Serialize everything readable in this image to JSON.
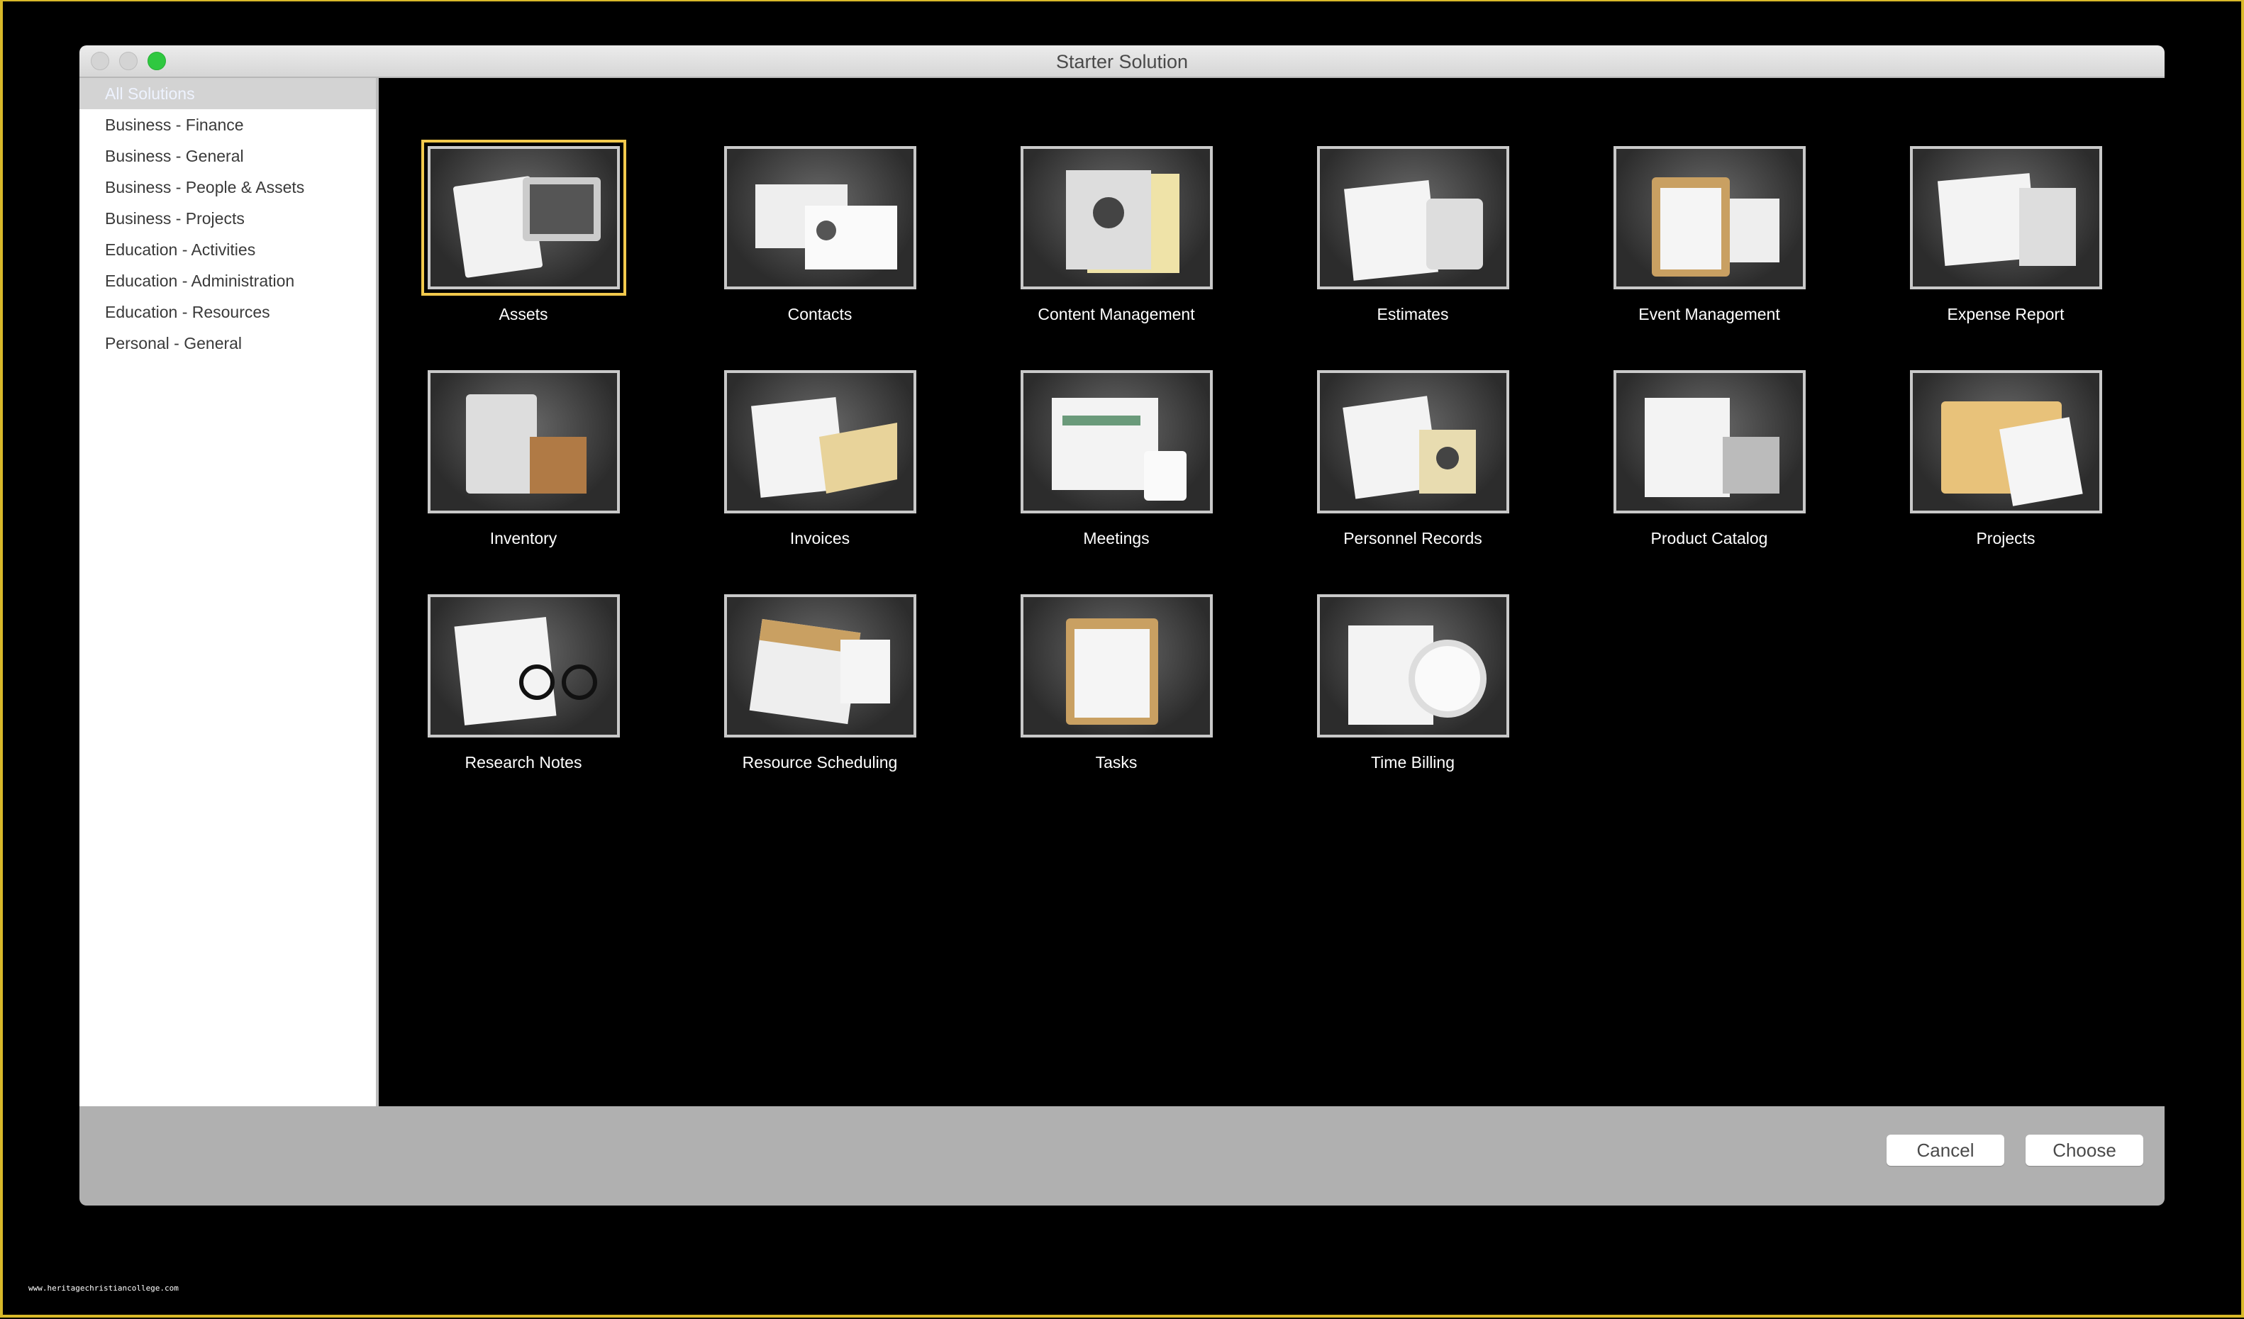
{
  "window": {
    "title": "Starter Solution"
  },
  "sidebar": {
    "items": [
      {
        "label": "All Solutions",
        "selected": true
      },
      {
        "label": "Business - Finance"
      },
      {
        "label": "Business - General"
      },
      {
        "label": "Business - People & Assets"
      },
      {
        "label": "Business - Projects"
      },
      {
        "label": "Education - Activities"
      },
      {
        "label": "Education - Administration"
      },
      {
        "label": "Education - Resources"
      },
      {
        "label": "Personal - General"
      }
    ]
  },
  "solutions": [
    {
      "label": "Assets",
      "icon": "assets-icon",
      "selected": true
    },
    {
      "label": "Contacts",
      "icon": "contacts-icon"
    },
    {
      "label": "Content Management",
      "icon": "content-management-icon"
    },
    {
      "label": "Estimates",
      "icon": "calculator-icon"
    },
    {
      "label": "Event Management",
      "icon": "calendar-clipboard-icon"
    },
    {
      "label": "Expense Report",
      "icon": "receipt-icon"
    },
    {
      "label": "Inventory",
      "icon": "boxes-icon"
    },
    {
      "label": "Invoices",
      "icon": "envelope-icon"
    },
    {
      "label": "Meetings",
      "icon": "coffee-notebook-icon"
    },
    {
      "label": "Personnel Records",
      "icon": "id-badge-icon"
    },
    {
      "label": "Product Catalog",
      "icon": "catalog-icon"
    },
    {
      "label": "Projects",
      "icon": "folder-icon"
    },
    {
      "label": "Research Notes",
      "icon": "glasses-notes-icon"
    },
    {
      "label": "Resource Scheduling",
      "icon": "schedule-icon"
    },
    {
      "label": "Tasks",
      "icon": "clipboard-check-icon"
    },
    {
      "label": "Time Billing",
      "icon": "clock-icon"
    }
  ],
  "footer": {
    "cancel_label": "Cancel",
    "choose_label": "Choose"
  },
  "watermark": "www.heritagechristiancollege.com",
  "colors": {
    "selection": "#f2c94c",
    "zoom_button": "#2ecc40"
  }
}
